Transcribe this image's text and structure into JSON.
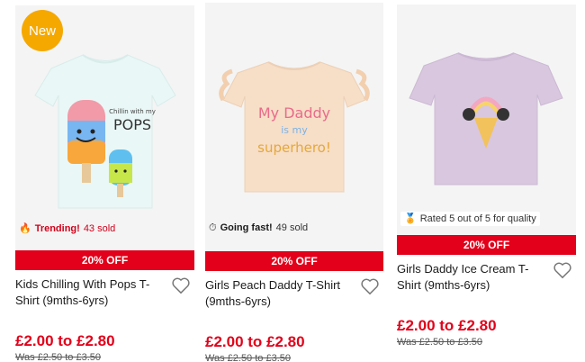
{
  "colors": {
    "accent_red": "#e2001a",
    "badge_orange": "#f5a800"
  },
  "products": [
    {
      "badge": "New",
      "image_alt": "Kids Chilling With Pops T-Shirt",
      "graphic_text": "Chillin with my",
      "graphic_text_2": "POPS",
      "status_icon": "fire-icon",
      "status_highlight": "Trending!",
      "status_rest": "43 sold",
      "discount": "20% OFF",
      "title": "Kids Chilling With Pops T-Shirt (9mths-6yrs)",
      "price": "£2.00 to £2.80",
      "was_price": "Was £2.50 to £3.50"
    },
    {
      "image_alt": "Girls Peach Daddy T-Shirt",
      "graphic_text": "My Daddy",
      "graphic_text_2": "is my",
      "graphic_text_3": "superhero!",
      "status_icon": "stopwatch-icon",
      "status_highlight": "Going fast!",
      "status_rest": "49 sold",
      "discount": "20% OFF",
      "title": "Girls Peach Daddy T-Shirt (9mths-6yrs)",
      "price": "£2.00 to £2.80",
      "was_price": "Was £2.50 to £3.50"
    },
    {
      "image_alt": "Girls Daddy Ice Cream T-Shirt",
      "status_icon": "medal-icon",
      "status_rest": "Rated 5 out of 5 for quality",
      "discount": "20% OFF",
      "title": "Girls Daddy Ice Cream T-Shirt (9mths-6yrs)",
      "price": "£2.00 to £2.80",
      "was_price": "Was £2.50 to £3.50"
    }
  ]
}
